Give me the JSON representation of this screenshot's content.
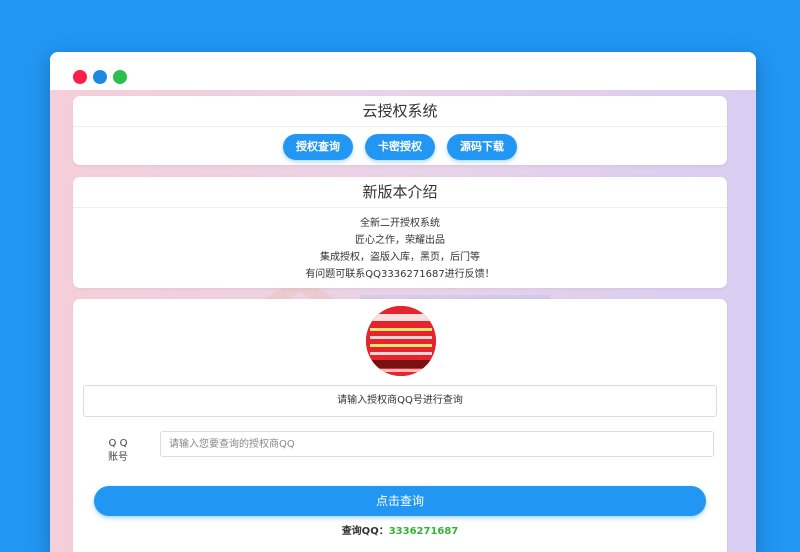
{
  "window": {
    "controls": [
      "close-dot",
      "minimize-dot",
      "maximize-dot"
    ],
    "colors": {
      "close": "#ff1f4b",
      "minimize": "#1e88e5",
      "maximize": "#2ebd4f"
    }
  },
  "header_card": {
    "title": "云授权系统",
    "buttons": [
      {
        "label": "授权查询"
      },
      {
        "label": "卡密授权"
      },
      {
        "label": "源码下载"
      }
    ]
  },
  "intro_card": {
    "title": "新版本介绍",
    "lines": [
      "全新二开授权系统",
      "匠心之作，荣耀出品",
      "集成授权，盗版入库，黑页，后门等",
      "有问题可联系QQ3336271687进行反馈！"
    ]
  },
  "query_card": {
    "avatar_icon": "promo-avatar-icon",
    "prompt": "请输入授权商QQ号进行查询",
    "qq_label_line1": "Q Q",
    "qq_label_line2": "账号",
    "qq_placeholder": "请输入您要查询的授权商QQ",
    "qq_value": "",
    "submit_label": "点击查询",
    "contact_label": "查询QQ：",
    "contact_number": "3336271687"
  },
  "colors": {
    "page_background": "#2196f3",
    "accent": "#2196f3",
    "contact_number": "#32b336"
  }
}
